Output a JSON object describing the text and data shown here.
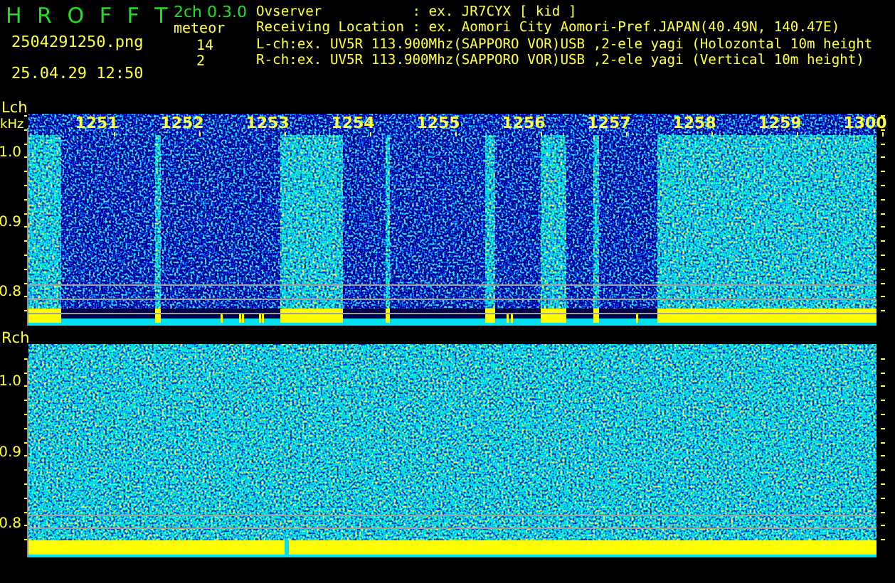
{
  "header": {
    "app_title": "H R O F F T",
    "version": "2ch 0.3.0",
    "file_name": "2504291250.png",
    "timestamp": "25.04.29 12:50",
    "meteor_label": "meteor",
    "counts": [
      "14",
      "2"
    ],
    "info_lines": [
      "Ovserver           : ex. JR7CYX [ kid ]",
      "Receiving Location : ex. Aomori City Aomori-Pref.JAPAN(40.49N, 140.47E)",
      "L-ch:ex. UV5R 113.900Mhz(SAPPORO VOR)USB ,2-ele yagi (Holozontal 10m height",
      "R-ch:ex. UV5R 113.900Mhz(SAPPORO VOR)USB ,2-ele yagi (Vertical 10m height)"
    ]
  },
  "channels": [
    {
      "label": "Lch",
      "unit": "kHz",
      "y_ticks": [
        "1.0",
        "0.9",
        "0.8"
      ],
      "time_labels": [
        "1251",
        "1252",
        "1253",
        "1254",
        "1255",
        "1256",
        "1257",
        "1258",
        "1259",
        "1300"
      ]
    },
    {
      "label": "Rch",
      "y_ticks": [
        "1.0",
        "0.9",
        "0.8"
      ]
    }
  ]
}
